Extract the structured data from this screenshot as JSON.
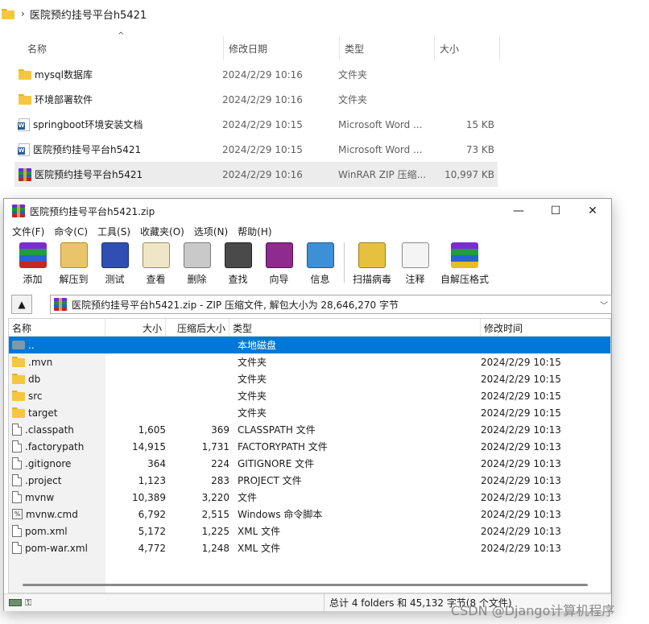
{
  "explorer": {
    "breadcrumb": "医院预约挂号平台h5421",
    "columns": {
      "name": "名称",
      "date": "修改日期",
      "type": "类型",
      "size": "大小"
    },
    "rows": [
      {
        "name": "mysql数据库",
        "date": "2024/2/29 10:16",
        "type": "文件夹",
        "size": "",
        "icon": "folder-icon"
      },
      {
        "name": "环境部署软件",
        "date": "2024/2/29 10:16",
        "type": "文件夹",
        "size": "",
        "icon": "folder-icon"
      },
      {
        "name": "springboot环境安装文档",
        "date": "2024/2/29 10:15",
        "type": "Microsoft Word ...",
        "size": "15 KB",
        "icon": "word-doc-icon"
      },
      {
        "name": "医院预约挂号平台h5421",
        "date": "2024/2/29 10:15",
        "type": "Microsoft Word ...",
        "size": "73 KB",
        "icon": "word-doc-icon"
      },
      {
        "name": "医院预约挂号平台h5421",
        "date": "2024/2/29 10:16",
        "type": "WinRAR ZIP 压缩...",
        "size": "10,997 KB",
        "icon": "rar-archive-icon",
        "selected": true
      }
    ]
  },
  "winrar": {
    "title": "医院预约挂号平台h5421.zip",
    "menu": [
      "文件(F)",
      "命令(C)",
      "工具(S)",
      "收藏夹(O)",
      "选项(N)",
      "帮助(H)"
    ],
    "toolbar": [
      "添加",
      "解压到",
      "测试",
      "查看",
      "删除",
      "查找",
      "向导",
      "信息",
      "扫描病毒",
      "注释",
      "自解压格式"
    ],
    "path": "医院预约挂号平台h5421.zip - ZIP 压缩文件, 解包大小为 28,646,270 字节",
    "columns": {
      "name": "名称",
      "size": "大小",
      "packed": "压缩后大小",
      "type": "类型",
      "modified": "修改时间"
    },
    "rows": [
      {
        "name": "..",
        "size": "",
        "packed": "",
        "type": "本地磁盘",
        "modified": "",
        "icon": "drive-icon",
        "selected": true
      },
      {
        "name": ".mvn",
        "size": "",
        "packed": "",
        "type": "文件夹",
        "modified": "2024/2/29 10:15",
        "icon": "folder-icon"
      },
      {
        "name": "db",
        "size": "",
        "packed": "",
        "type": "文件夹",
        "modified": "2024/2/29 10:15",
        "icon": "folder-icon"
      },
      {
        "name": "src",
        "size": "",
        "packed": "",
        "type": "文件夹",
        "modified": "2024/2/29 10:15",
        "icon": "folder-icon"
      },
      {
        "name": "target",
        "size": "",
        "packed": "",
        "type": "文件夹",
        "modified": "2024/2/29 10:15",
        "icon": "folder-icon"
      },
      {
        "name": ".classpath",
        "size": "1,605",
        "packed": "369",
        "type": "CLASSPATH 文件",
        "modified": "2024/2/29 10:13",
        "icon": "file-icon"
      },
      {
        "name": ".factorypath",
        "size": "14,915",
        "packed": "1,731",
        "type": "FACTORYPATH 文件",
        "modified": "2024/2/29 10:13",
        "icon": "file-icon"
      },
      {
        "name": ".gitignore",
        "size": "364",
        "packed": "224",
        "type": "GITIGNORE 文件",
        "modified": "2024/2/29 10:13",
        "icon": "file-icon"
      },
      {
        "name": ".project",
        "size": "1,123",
        "packed": "283",
        "type": "PROJECT 文件",
        "modified": "2024/2/29 10:13",
        "icon": "file-icon"
      },
      {
        "name": "mvnw",
        "size": "10,389",
        "packed": "3,220",
        "type": "文件",
        "modified": "2024/2/29 10:13",
        "icon": "file-icon"
      },
      {
        "name": "mvnw.cmd",
        "size": "6,792",
        "packed": "2,515",
        "type": "Windows 命令脚本",
        "modified": "2024/2/29 10:13",
        "icon": "cmd-script-icon"
      },
      {
        "name": "pom.xml",
        "size": "5,172",
        "packed": "1,225",
        "type": "XML 文件",
        "modified": "2024/2/29 10:13",
        "icon": "file-icon"
      },
      {
        "name": "pom-war.xml",
        "size": "4,772",
        "packed": "1,248",
        "type": "XML 文件",
        "modified": "2024/2/29 10:13",
        "icon": "file-icon"
      }
    ],
    "status": "总计 4 folders 和 45,132 字节(8 个文件)"
  },
  "watermark": "CSDN @Django计算机程序"
}
